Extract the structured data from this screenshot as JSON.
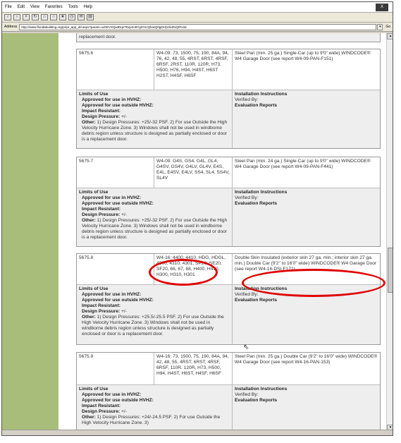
{
  "menu": [
    "File",
    "Edit",
    "View",
    "Favorites",
    "Tools",
    "Help"
  ],
  "window_button": "X",
  "toolbar_icons": [
    "back-icon",
    "forward-icon",
    "stop-icon",
    "refresh-icon",
    "home-icon",
    "search-icon",
    "favorites-icon",
    "history-icon",
    "mail-icon",
    "print-icon"
  ],
  "address": {
    "label": "Address",
    "url": "http://www.floridabuilding.org/pr/pr_app_dtl.aspx?param=wGEVXQwtDqsTDqv2o9Yg37ezQfvwQ0gDH|12eZNQ0%3d",
    "go": "Go"
  },
  "top_partial": "replacement door.",
  "entries": [
    {
      "id": "5675.6",
      "models": "W4-09: 73, 1500, 75, 190, 84A, 94, 76, 42, 48, 55, 4RST, 6RST, 4RSF, 6RSF, 2RST, 110R, 120R, H73, H500, H76, H94, H4ST, H6ST H2ST, H4SF, H6SF",
      "description": "Steel Pan (min. 25 ga.) Single-Car (up to 9'0\" wide) WINDCODE® W4 Garage Door (see report W4-09-PAN-F151)",
      "limits_title": "Limits of Use",
      "hvhz_in": "Approved for use in HVHZ:",
      "hvhz_out": "Approved for use outside HVHZ:",
      "impact": "Impact Resistant:",
      "pressure_label": "Design Pressure:",
      "pressure_value": " +/-",
      "other_label": "Other:",
      "other_text": " 1) Design Pressures: +25/-32 PSF. 2) For use Outside the High Velocity Hurricane Zone. 3) Windows shall not be used in windborne debris region unless structure is designed as partially enclosed or door is a replacement door.",
      "install_title": "Installation Instructions",
      "verified": "Verified By:",
      "eval": "Evaluation Reports"
    },
    {
      "id": "5675.7",
      "models": "W4-09: G4S, GS4, G4L, GL4, G4SV, GS4V, G4LV, GL4V, E4S, E4L, E4SV, E4LV, SS4, SL4, SS4V, SL4V",
      "description": "Steel Pan (min. 24 ga.) Single-Car (up to 9'0\" wide) WINDCODE® W4 Garage Door (see report W4-09-PAN-F441)",
      "limits_title": "Limits of Use",
      "hvhz_in": "Approved for use in HVHZ:",
      "hvhz_out": "Approved for use outside HVHZ:",
      "impact": "Impact Resistant:",
      "pressure_label": "Design Pressure:",
      "pressure_value": " +/-",
      "other_label": "Other:",
      "other_text": " 1) Design Pressures: +25/-32 PSF. 2) For use Outside the High Velocity Hurricane Zone. 3) Windows shall not be used in windborne debris region unless structure is designed as partially enclosed or door is a replacement door.",
      "install_title": "Installation Instructions",
      "verified": "Verified By:",
      "eval": "Evaluation Reports"
    },
    {
      "id": "5675.8",
      "models": "W4-16: 4400, 4410, HDG, HDGL, 4300, 4310, 4301, SP20, SE20, SF20, 66, 67, 68, H400, H410, H300, H310, H301",
      "description": "Double Skin Insulated (exterior skin 27 ga. min.; interior skin 27 ga. min.) Double Car (9'2\" to 16'0\" wide) WINDCODE® W4 Garage Door (see report W4-16-DSI-F171)",
      "limits_title": "Limits of Use",
      "hvhz_in": "Approved for use in HVHZ:",
      "hvhz_out": "Approved for use outside HVHZ:",
      "impact": "Impact Resistant:",
      "pressure_label": "Design Pressure:",
      "pressure_value": " +/-",
      "other_label": "Other:",
      "other_text": " 1) Design Pressures: +25.5/-25.5 PSF. 2) For use Outside the High Velocity Hurricane Zone. 3) Windows shall not be used in windborne debris region unless structure is designed as partially enclosed or door is a replacement door.",
      "install_title": "Installation Instructions",
      "verified": "Verified By:",
      "eval": "Evaluation Reports"
    },
    {
      "id": "5675.9",
      "models": "W4-16: 73, 1500, 75, 190, 84A, 94, 42, 48, 55, 4RST, 6RST, 4RSF, 6RSF, 110R, 120R, H73, H500, H94, H4ST, H6ST, H4SF, H6SF",
      "description": "Steel Pan (min. 25 ga.) Double Car (9'2\" to 16'0\" wide) WINDCODE® W4 Garage Door (see report W4-16-PAN-153)",
      "limits_title": "Limits of Use",
      "hvhz_in": "Approved for use in HVHZ:",
      "hvhz_out": "Approved for use outside HVHZ:",
      "impact": "Impact Resistant:",
      "pressure_label": "Design Pressure:",
      "pressure_value": " +/-",
      "other_label": "Other:",
      "other_text": " 1) Design Pressures: +24/-24.5 PSF. 2) For use Outside the High Velocity Hurricane Zone. 3)",
      "install_title": "Installation Instructions",
      "verified": "Verified By:",
      "eval": "Evaluation Reports"
    }
  ],
  "colors": {
    "sidebar": "#a9bd7a",
    "annotation": "#e00000"
  }
}
